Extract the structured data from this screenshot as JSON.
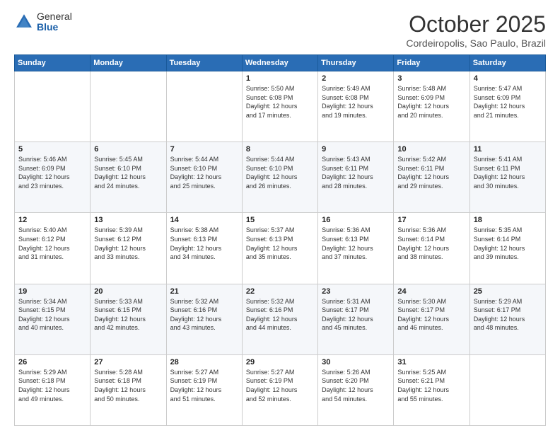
{
  "header": {
    "logo_general": "General",
    "logo_blue": "Blue",
    "month_title": "October 2025",
    "location": "Cordeiropolis, Sao Paulo, Brazil"
  },
  "weekdays": [
    "Sunday",
    "Monday",
    "Tuesday",
    "Wednesday",
    "Thursday",
    "Friday",
    "Saturday"
  ],
  "weeks": [
    [
      {
        "day": "",
        "info": ""
      },
      {
        "day": "",
        "info": ""
      },
      {
        "day": "",
        "info": ""
      },
      {
        "day": "1",
        "info": "Sunrise: 5:50 AM\nSunset: 6:08 PM\nDaylight: 12 hours\nand 17 minutes."
      },
      {
        "day": "2",
        "info": "Sunrise: 5:49 AM\nSunset: 6:08 PM\nDaylight: 12 hours\nand 19 minutes."
      },
      {
        "day": "3",
        "info": "Sunrise: 5:48 AM\nSunset: 6:09 PM\nDaylight: 12 hours\nand 20 minutes."
      },
      {
        "day": "4",
        "info": "Sunrise: 5:47 AM\nSunset: 6:09 PM\nDaylight: 12 hours\nand 21 minutes."
      }
    ],
    [
      {
        "day": "5",
        "info": "Sunrise: 5:46 AM\nSunset: 6:09 PM\nDaylight: 12 hours\nand 23 minutes."
      },
      {
        "day": "6",
        "info": "Sunrise: 5:45 AM\nSunset: 6:10 PM\nDaylight: 12 hours\nand 24 minutes."
      },
      {
        "day": "7",
        "info": "Sunrise: 5:44 AM\nSunset: 6:10 PM\nDaylight: 12 hours\nand 25 minutes."
      },
      {
        "day": "8",
        "info": "Sunrise: 5:44 AM\nSunset: 6:10 PM\nDaylight: 12 hours\nand 26 minutes."
      },
      {
        "day": "9",
        "info": "Sunrise: 5:43 AM\nSunset: 6:11 PM\nDaylight: 12 hours\nand 28 minutes."
      },
      {
        "day": "10",
        "info": "Sunrise: 5:42 AM\nSunset: 6:11 PM\nDaylight: 12 hours\nand 29 minutes."
      },
      {
        "day": "11",
        "info": "Sunrise: 5:41 AM\nSunset: 6:11 PM\nDaylight: 12 hours\nand 30 minutes."
      }
    ],
    [
      {
        "day": "12",
        "info": "Sunrise: 5:40 AM\nSunset: 6:12 PM\nDaylight: 12 hours\nand 31 minutes."
      },
      {
        "day": "13",
        "info": "Sunrise: 5:39 AM\nSunset: 6:12 PM\nDaylight: 12 hours\nand 33 minutes."
      },
      {
        "day": "14",
        "info": "Sunrise: 5:38 AM\nSunset: 6:13 PM\nDaylight: 12 hours\nand 34 minutes."
      },
      {
        "day": "15",
        "info": "Sunrise: 5:37 AM\nSunset: 6:13 PM\nDaylight: 12 hours\nand 35 minutes."
      },
      {
        "day": "16",
        "info": "Sunrise: 5:36 AM\nSunset: 6:13 PM\nDaylight: 12 hours\nand 37 minutes."
      },
      {
        "day": "17",
        "info": "Sunrise: 5:36 AM\nSunset: 6:14 PM\nDaylight: 12 hours\nand 38 minutes."
      },
      {
        "day": "18",
        "info": "Sunrise: 5:35 AM\nSunset: 6:14 PM\nDaylight: 12 hours\nand 39 minutes."
      }
    ],
    [
      {
        "day": "19",
        "info": "Sunrise: 5:34 AM\nSunset: 6:15 PM\nDaylight: 12 hours\nand 40 minutes."
      },
      {
        "day": "20",
        "info": "Sunrise: 5:33 AM\nSunset: 6:15 PM\nDaylight: 12 hours\nand 42 minutes."
      },
      {
        "day": "21",
        "info": "Sunrise: 5:32 AM\nSunset: 6:16 PM\nDaylight: 12 hours\nand 43 minutes."
      },
      {
        "day": "22",
        "info": "Sunrise: 5:32 AM\nSunset: 6:16 PM\nDaylight: 12 hours\nand 44 minutes."
      },
      {
        "day": "23",
        "info": "Sunrise: 5:31 AM\nSunset: 6:17 PM\nDaylight: 12 hours\nand 45 minutes."
      },
      {
        "day": "24",
        "info": "Sunrise: 5:30 AM\nSunset: 6:17 PM\nDaylight: 12 hours\nand 46 minutes."
      },
      {
        "day": "25",
        "info": "Sunrise: 5:29 AM\nSunset: 6:17 PM\nDaylight: 12 hours\nand 48 minutes."
      }
    ],
    [
      {
        "day": "26",
        "info": "Sunrise: 5:29 AM\nSunset: 6:18 PM\nDaylight: 12 hours\nand 49 minutes."
      },
      {
        "day": "27",
        "info": "Sunrise: 5:28 AM\nSunset: 6:18 PM\nDaylight: 12 hours\nand 50 minutes."
      },
      {
        "day": "28",
        "info": "Sunrise: 5:27 AM\nSunset: 6:19 PM\nDaylight: 12 hours\nand 51 minutes."
      },
      {
        "day": "29",
        "info": "Sunrise: 5:27 AM\nSunset: 6:19 PM\nDaylight: 12 hours\nand 52 minutes."
      },
      {
        "day": "30",
        "info": "Sunrise: 5:26 AM\nSunset: 6:20 PM\nDaylight: 12 hours\nand 54 minutes."
      },
      {
        "day": "31",
        "info": "Sunrise: 5:25 AM\nSunset: 6:21 PM\nDaylight: 12 hours\nand 55 minutes."
      },
      {
        "day": "",
        "info": ""
      }
    ]
  ]
}
